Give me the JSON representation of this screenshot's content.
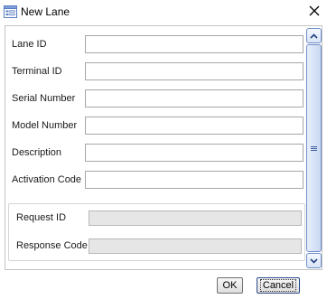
{
  "window": {
    "title": "New Lane",
    "icon": "form-window-icon",
    "close_symbol": "✕"
  },
  "form": {
    "fields": [
      {
        "label": "Lane ID",
        "value": ""
      },
      {
        "label": "Terminal ID",
        "value": ""
      },
      {
        "label": "Serial Number",
        "value": ""
      },
      {
        "label": "Model Number",
        "value": ""
      },
      {
        "label": "Description",
        "value": ""
      },
      {
        "label": "Activation Code",
        "value": ""
      }
    ],
    "readonly_fields": [
      {
        "label": "Request ID",
        "value": ""
      },
      {
        "label": "Response Code",
        "value": ""
      }
    ]
  },
  "buttons": {
    "ok_label": "OK",
    "cancel_label": "Cancel"
  },
  "colors": {
    "accent": "#6f8ec8",
    "readonly_bg": "#e6e6e6"
  }
}
